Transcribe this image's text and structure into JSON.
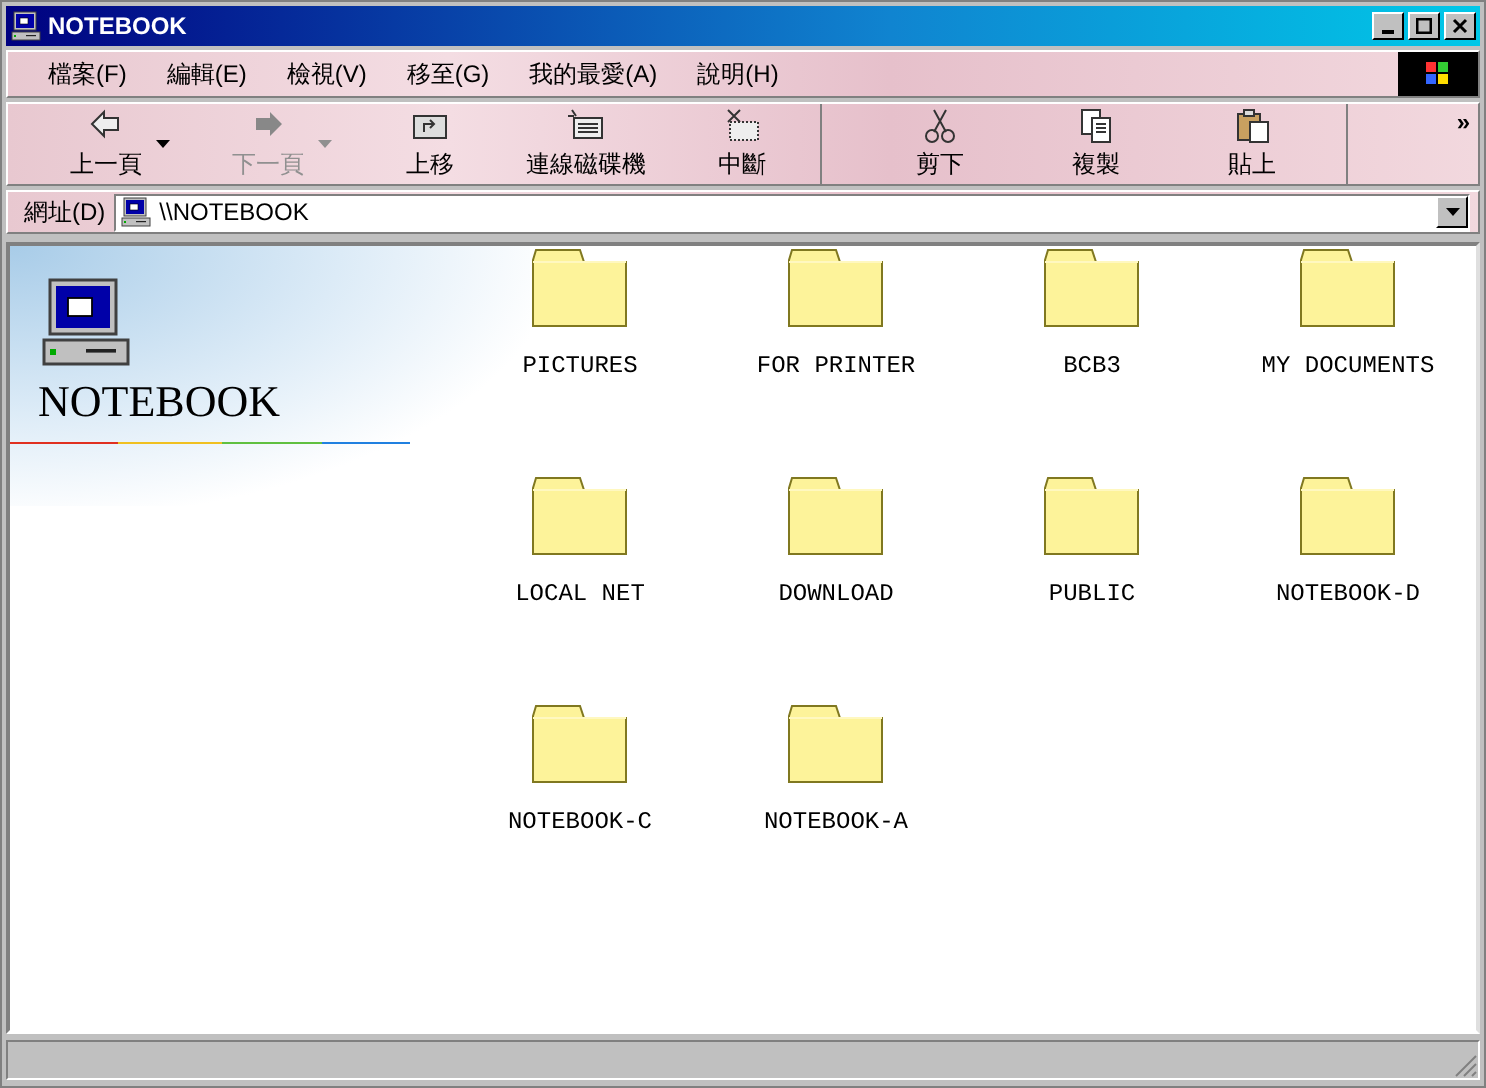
{
  "window": {
    "title": "NOTEBOOK"
  },
  "menu": [
    "檔案(F)",
    "編輯(E)",
    "檢視(V)",
    "移至(G)",
    "我的最愛(A)",
    "說明(H)"
  ],
  "toolbar": {
    "groups": [
      [
        {
          "label": "上一頁",
          "disabled": false,
          "dropdown": true
        },
        {
          "label": "下一頁",
          "disabled": true,
          "dropdown": true
        },
        {
          "label": "上移",
          "disabled": false,
          "dropdown": false
        },
        {
          "label": "連線磁碟機",
          "disabled": false,
          "dropdown": false
        },
        {
          "label": "中斷",
          "disabled": false,
          "dropdown": false
        }
      ],
      [
        {
          "label": "剪下",
          "disabled": false,
          "dropdown": false
        },
        {
          "label": "複製",
          "disabled": false,
          "dropdown": false
        },
        {
          "label": "貼上",
          "disabled": false,
          "dropdown": false
        }
      ]
    ],
    "more": "»"
  },
  "address": {
    "label": "網址(D)",
    "value": "\\\\NOTEBOOK"
  },
  "sidebar": {
    "title": "NOTEBOOK"
  },
  "items": [
    {
      "name": "PICTURES"
    },
    {
      "name": "FOR PRINTER"
    },
    {
      "name": "BCB3"
    },
    {
      "name": "MY DOCUMENTS"
    },
    {
      "name": "LOCAL NET"
    },
    {
      "name": "DOWNLOAD"
    },
    {
      "name": "PUBLIC"
    },
    {
      "name": "NOTEBOOK-D"
    },
    {
      "name": "NOTEBOOK-C"
    },
    {
      "name": "NOTEBOOK-A"
    }
  ]
}
